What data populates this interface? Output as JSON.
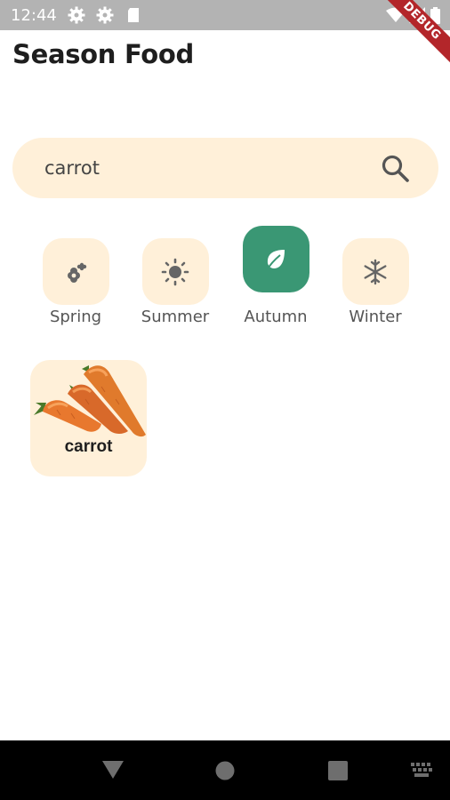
{
  "status_bar": {
    "time": "12:44",
    "debug_label": "DEBUG"
  },
  "app": {
    "title": "Season Food"
  },
  "search": {
    "value": "carrot"
  },
  "seasons": [
    {
      "label": "Spring",
      "icon": "flower-icon",
      "active": false
    },
    {
      "label": "Summer",
      "icon": "sun-icon",
      "active": false
    },
    {
      "label": "Autumn",
      "icon": "leaf-icon",
      "active": true
    },
    {
      "label": "Winter",
      "icon": "snowflake-icon",
      "active": false
    }
  ],
  "results": [
    {
      "name": "carrot",
      "image": "carrot-image"
    }
  ],
  "colors": {
    "accent": "#3a9774",
    "tile": "#fff0d9",
    "ribbon": "#b3262a"
  }
}
